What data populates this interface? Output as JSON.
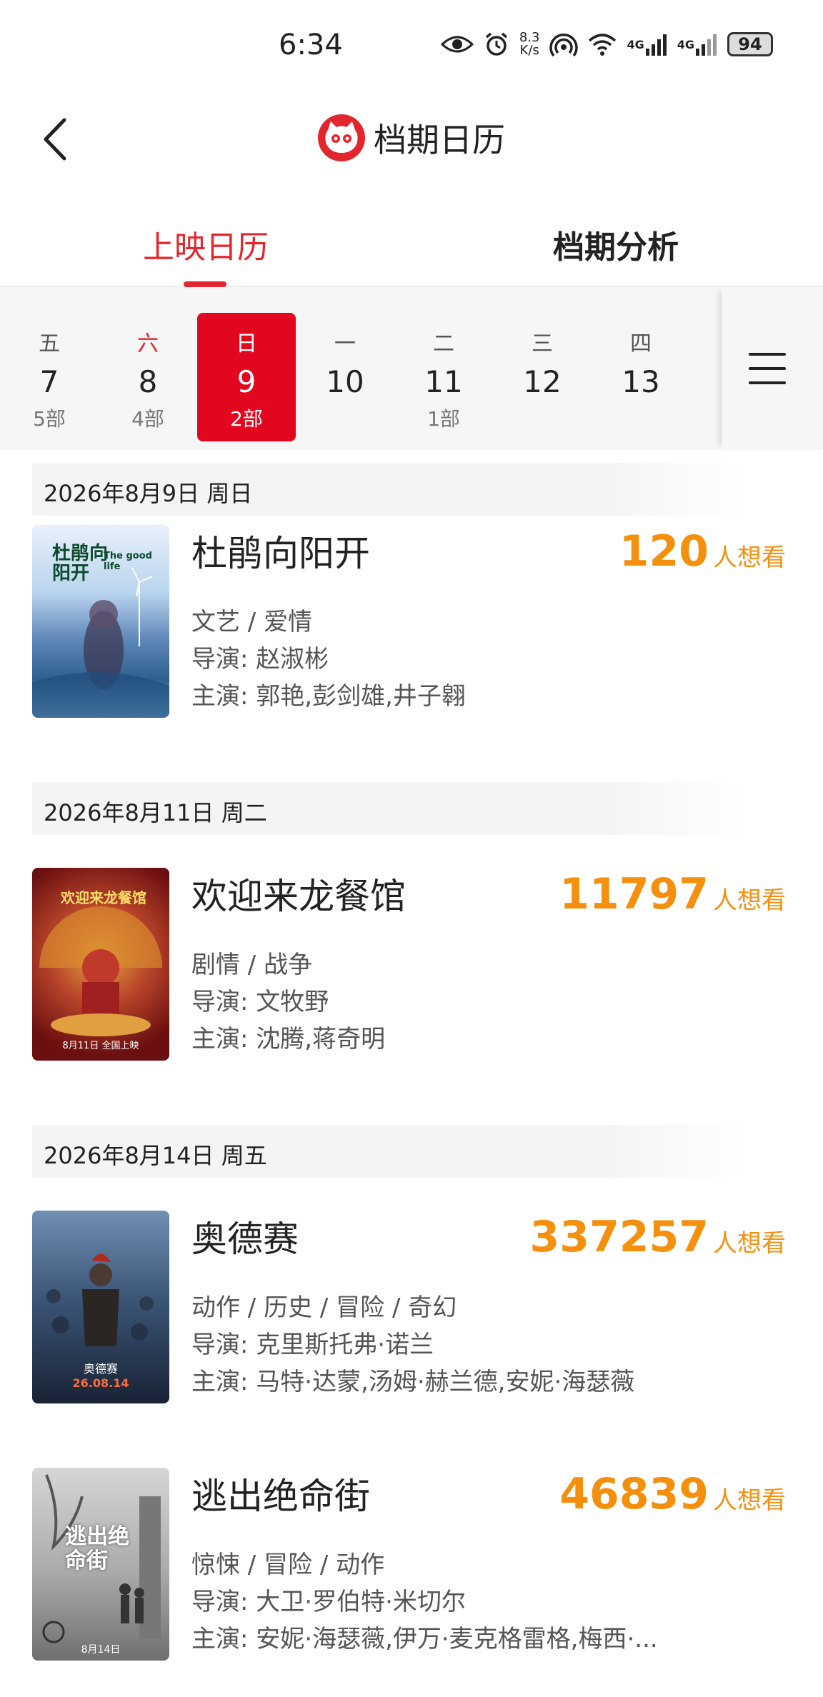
{
  "status": {
    "time": "6:34",
    "net_speed_top": "8.3",
    "net_speed_bottom": "K/s",
    "signal_label_1": "4G",
    "signal_label_2": "4G",
    "battery": "94"
  },
  "header": {
    "title": "档期日历"
  },
  "tabs": [
    {
      "label": "上映日历",
      "active": true
    },
    {
      "label": "档期分析",
      "active": false
    }
  ],
  "dates": [
    {
      "weekday": "五",
      "day": "7",
      "count": "5部"
    },
    {
      "weekday": "六",
      "day": "8",
      "count": "4部"
    },
    {
      "weekday": "日",
      "day": "9",
      "count": "2部"
    },
    {
      "weekday": "一",
      "day": "10",
      "count": ""
    },
    {
      "weekday": "二",
      "day": "11",
      "count": "1部"
    },
    {
      "weekday": "三",
      "day": "12",
      "count": ""
    },
    {
      "weekday": "四",
      "day": "13",
      "count": ""
    }
  ],
  "sections": [
    {
      "date_label": "2026年8月9日  周日"
    },
    {
      "date_label": "2026年8月11日  周二"
    },
    {
      "date_label": "2026年8月14日  周五"
    }
  ],
  "movies": [
    {
      "title": "杜鹃向阳开",
      "want_count": "120",
      "want_label": "人想看",
      "genres": "文艺 / 爱情",
      "director": "导演: 赵淑彬",
      "cast": "主演: 郭艳,彭剑雄,井子翱",
      "poster_title": "杜鹃向阳开",
      "poster_sub": "The good life"
    },
    {
      "title": "欢迎来龙餐馆",
      "want_count": "11797",
      "want_label": "人想看",
      "genres": "剧情 / 战争",
      "director": "导演: 文牧野",
      "cast": "主演: 沈腾,蒋奇明",
      "poster_title": "欢迎来龙餐馆",
      "poster_sub": "8月11日 全国上映"
    },
    {
      "title": "奥德赛",
      "want_count": "337257",
      "want_label": "人想看",
      "genres": "动作 / 历史 / 冒险 / 奇幻",
      "director": "导演: 克里斯托弗·诺兰",
      "cast": "主演: 马特·达蒙,汤姆·赫兰德,安妮·海瑟薇",
      "poster_title": "奥德赛",
      "poster_sub": "26.08.14"
    },
    {
      "title": "逃出绝命街",
      "want_count": "46839",
      "want_label": "人想看",
      "genres": "惊悚 / 冒险 / 动作",
      "director": "导演: 大卫·罗伯特·米切尔",
      "cast": "主演: 安妮·海瑟薇,伊万·麦克格雷格,梅西·...",
      "poster_title": "逃出绝命街",
      "poster_sub": "8月14日"
    }
  ],
  "colors": {
    "accent": "#e3262d",
    "want": "#f5900f"
  }
}
